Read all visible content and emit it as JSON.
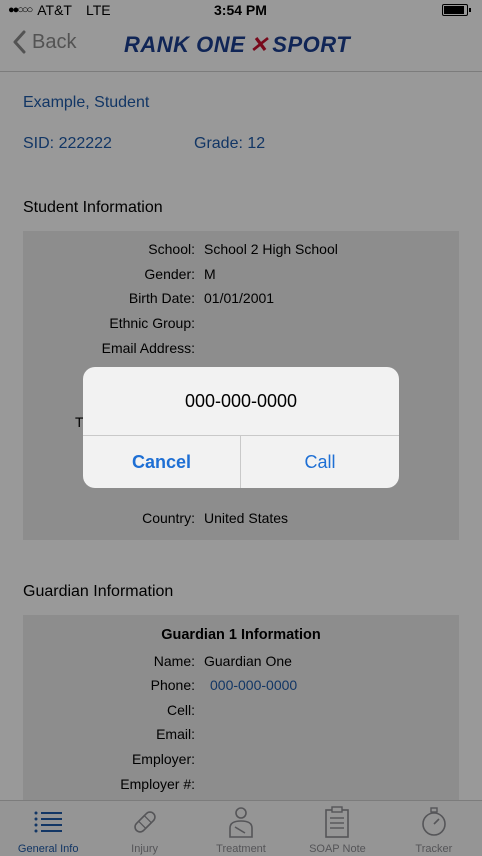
{
  "status_bar": {
    "carrier": "AT&T",
    "network": "LTE",
    "time": "3:54 PM",
    "battery_level": 0.85
  },
  "nav": {
    "back_label": "Back",
    "logo_left": "RANK ONE",
    "logo_right": "SPORT"
  },
  "student": {
    "name": "Example, Student",
    "sid": "SID: 222222",
    "grade": "Grade: 12"
  },
  "student_info": {
    "title": "Student Information",
    "rows": [
      {
        "label": "School:",
        "value": "School 2 High School"
      },
      {
        "label": "Gender:",
        "value": "M"
      },
      {
        "label": "Birth Date:",
        "value": "01/01/2001"
      },
      {
        "label": "Ethnic Group:",
        "value": ""
      },
      {
        "label": "Email Address:",
        "value": ""
      }
    ],
    "partial_label": "T",
    "country_label": "Country:",
    "country_value": "United States"
  },
  "guardian_info": {
    "title": "Guardian Information",
    "header": "Guardian 1 Information",
    "rows": [
      {
        "label": "Name:",
        "value": "Guardian One",
        "link": false
      },
      {
        "label": "Phone:",
        "value": "000-000-0000",
        "link": true
      },
      {
        "label": "Cell:",
        "value": "",
        "link": false
      },
      {
        "label": "Email:",
        "value": "",
        "link": false
      },
      {
        "label": "Employer:",
        "value": "",
        "link": false
      },
      {
        "label": "Employer #:",
        "value": "",
        "link": false
      }
    ]
  },
  "dialog": {
    "title": "000-000-0000",
    "cancel_label": "Cancel",
    "call_label": "Call"
  },
  "tabs": [
    {
      "label": "General Info",
      "icon": "list-icon",
      "active": true
    },
    {
      "label": "Injury",
      "icon": "bandage-icon",
      "active": false
    },
    {
      "label": "Treatment",
      "icon": "person-sling-icon",
      "active": false
    },
    {
      "label": "SOAP Note",
      "icon": "clipboard-icon",
      "active": false
    },
    {
      "label": "Tracker",
      "icon": "stopwatch-icon",
      "active": false
    }
  ],
  "colors": {
    "accent": "#1e5aa8",
    "alert_button": "#1e6fd4",
    "brand_red": "#c8102e"
  }
}
